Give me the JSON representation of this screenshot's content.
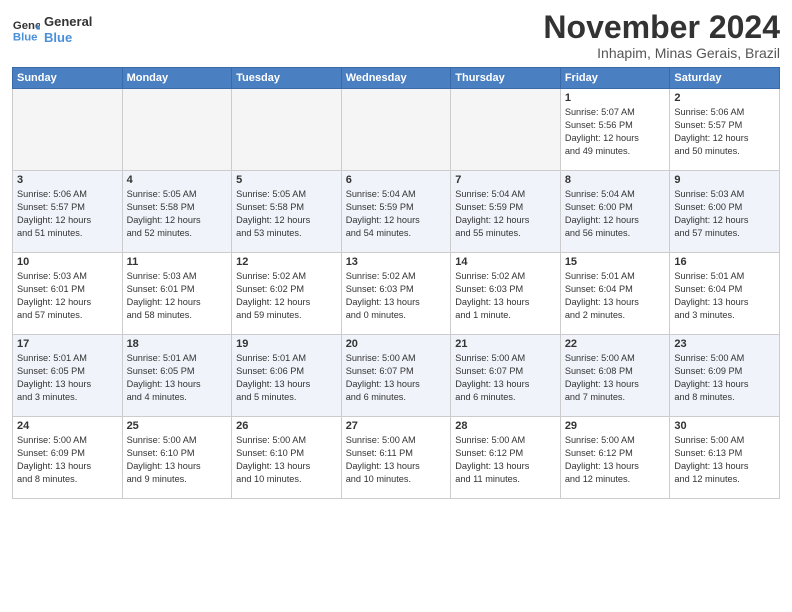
{
  "logo": {
    "line1": "General",
    "line2": "Blue"
  },
  "title": "November 2024",
  "subtitle": "Inhapim, Minas Gerais, Brazil",
  "days_of_week": [
    "Sunday",
    "Monday",
    "Tuesday",
    "Wednesday",
    "Thursday",
    "Friday",
    "Saturday"
  ],
  "weeks": [
    [
      {
        "day": "",
        "info": ""
      },
      {
        "day": "",
        "info": ""
      },
      {
        "day": "",
        "info": ""
      },
      {
        "day": "",
        "info": ""
      },
      {
        "day": "",
        "info": ""
      },
      {
        "day": "1",
        "info": "Sunrise: 5:07 AM\nSunset: 5:56 PM\nDaylight: 12 hours\nand 49 minutes."
      },
      {
        "day": "2",
        "info": "Sunrise: 5:06 AM\nSunset: 5:57 PM\nDaylight: 12 hours\nand 50 minutes."
      }
    ],
    [
      {
        "day": "3",
        "info": "Sunrise: 5:06 AM\nSunset: 5:57 PM\nDaylight: 12 hours\nand 51 minutes."
      },
      {
        "day": "4",
        "info": "Sunrise: 5:05 AM\nSunset: 5:58 PM\nDaylight: 12 hours\nand 52 minutes."
      },
      {
        "day": "5",
        "info": "Sunrise: 5:05 AM\nSunset: 5:58 PM\nDaylight: 12 hours\nand 53 minutes."
      },
      {
        "day": "6",
        "info": "Sunrise: 5:04 AM\nSunset: 5:59 PM\nDaylight: 12 hours\nand 54 minutes."
      },
      {
        "day": "7",
        "info": "Sunrise: 5:04 AM\nSunset: 5:59 PM\nDaylight: 12 hours\nand 55 minutes."
      },
      {
        "day": "8",
        "info": "Sunrise: 5:04 AM\nSunset: 6:00 PM\nDaylight: 12 hours\nand 56 minutes."
      },
      {
        "day": "9",
        "info": "Sunrise: 5:03 AM\nSunset: 6:00 PM\nDaylight: 12 hours\nand 57 minutes."
      }
    ],
    [
      {
        "day": "10",
        "info": "Sunrise: 5:03 AM\nSunset: 6:01 PM\nDaylight: 12 hours\nand 57 minutes."
      },
      {
        "day": "11",
        "info": "Sunrise: 5:03 AM\nSunset: 6:01 PM\nDaylight: 12 hours\nand 58 minutes."
      },
      {
        "day": "12",
        "info": "Sunrise: 5:02 AM\nSunset: 6:02 PM\nDaylight: 12 hours\nand 59 minutes."
      },
      {
        "day": "13",
        "info": "Sunrise: 5:02 AM\nSunset: 6:03 PM\nDaylight: 13 hours\nand 0 minutes."
      },
      {
        "day": "14",
        "info": "Sunrise: 5:02 AM\nSunset: 6:03 PM\nDaylight: 13 hours\nand 1 minute."
      },
      {
        "day": "15",
        "info": "Sunrise: 5:01 AM\nSunset: 6:04 PM\nDaylight: 13 hours\nand 2 minutes."
      },
      {
        "day": "16",
        "info": "Sunrise: 5:01 AM\nSunset: 6:04 PM\nDaylight: 13 hours\nand 3 minutes."
      }
    ],
    [
      {
        "day": "17",
        "info": "Sunrise: 5:01 AM\nSunset: 6:05 PM\nDaylight: 13 hours\nand 3 minutes."
      },
      {
        "day": "18",
        "info": "Sunrise: 5:01 AM\nSunset: 6:05 PM\nDaylight: 13 hours\nand 4 minutes."
      },
      {
        "day": "19",
        "info": "Sunrise: 5:01 AM\nSunset: 6:06 PM\nDaylight: 13 hours\nand 5 minutes."
      },
      {
        "day": "20",
        "info": "Sunrise: 5:00 AM\nSunset: 6:07 PM\nDaylight: 13 hours\nand 6 minutes."
      },
      {
        "day": "21",
        "info": "Sunrise: 5:00 AM\nSunset: 6:07 PM\nDaylight: 13 hours\nand 6 minutes."
      },
      {
        "day": "22",
        "info": "Sunrise: 5:00 AM\nSunset: 6:08 PM\nDaylight: 13 hours\nand 7 minutes."
      },
      {
        "day": "23",
        "info": "Sunrise: 5:00 AM\nSunset: 6:09 PM\nDaylight: 13 hours\nand 8 minutes."
      }
    ],
    [
      {
        "day": "24",
        "info": "Sunrise: 5:00 AM\nSunset: 6:09 PM\nDaylight: 13 hours\nand 8 minutes."
      },
      {
        "day": "25",
        "info": "Sunrise: 5:00 AM\nSunset: 6:10 PM\nDaylight: 13 hours\nand 9 minutes."
      },
      {
        "day": "26",
        "info": "Sunrise: 5:00 AM\nSunset: 6:10 PM\nDaylight: 13 hours\nand 10 minutes."
      },
      {
        "day": "27",
        "info": "Sunrise: 5:00 AM\nSunset: 6:11 PM\nDaylight: 13 hours\nand 10 minutes."
      },
      {
        "day": "28",
        "info": "Sunrise: 5:00 AM\nSunset: 6:12 PM\nDaylight: 13 hours\nand 11 minutes."
      },
      {
        "day": "29",
        "info": "Sunrise: 5:00 AM\nSunset: 6:12 PM\nDaylight: 13 hours\nand 12 minutes."
      },
      {
        "day": "30",
        "info": "Sunrise: 5:00 AM\nSunset: 6:13 PM\nDaylight: 13 hours\nand 12 minutes."
      }
    ]
  ]
}
